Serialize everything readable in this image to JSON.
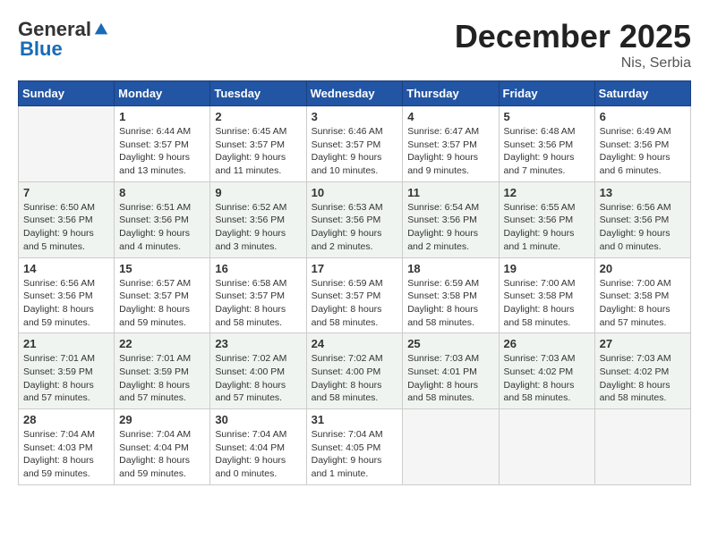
{
  "logo": {
    "general": "General",
    "blue": "Blue"
  },
  "title": "December 2025",
  "location": "Nis, Serbia",
  "days_of_week": [
    "Sunday",
    "Monday",
    "Tuesday",
    "Wednesday",
    "Thursday",
    "Friday",
    "Saturday"
  ],
  "weeks": [
    [
      {
        "day": "",
        "info": ""
      },
      {
        "day": "1",
        "info": "Sunrise: 6:44 AM\nSunset: 3:57 PM\nDaylight: 9 hours\nand 13 minutes."
      },
      {
        "day": "2",
        "info": "Sunrise: 6:45 AM\nSunset: 3:57 PM\nDaylight: 9 hours\nand 11 minutes."
      },
      {
        "day": "3",
        "info": "Sunrise: 6:46 AM\nSunset: 3:57 PM\nDaylight: 9 hours\nand 10 minutes."
      },
      {
        "day": "4",
        "info": "Sunrise: 6:47 AM\nSunset: 3:57 PM\nDaylight: 9 hours\nand 9 minutes."
      },
      {
        "day": "5",
        "info": "Sunrise: 6:48 AM\nSunset: 3:56 PM\nDaylight: 9 hours\nand 7 minutes."
      },
      {
        "day": "6",
        "info": "Sunrise: 6:49 AM\nSunset: 3:56 PM\nDaylight: 9 hours\nand 6 minutes."
      }
    ],
    [
      {
        "day": "7",
        "info": "Sunrise: 6:50 AM\nSunset: 3:56 PM\nDaylight: 9 hours\nand 5 minutes."
      },
      {
        "day": "8",
        "info": "Sunrise: 6:51 AM\nSunset: 3:56 PM\nDaylight: 9 hours\nand 4 minutes."
      },
      {
        "day": "9",
        "info": "Sunrise: 6:52 AM\nSunset: 3:56 PM\nDaylight: 9 hours\nand 3 minutes."
      },
      {
        "day": "10",
        "info": "Sunrise: 6:53 AM\nSunset: 3:56 PM\nDaylight: 9 hours\nand 2 minutes."
      },
      {
        "day": "11",
        "info": "Sunrise: 6:54 AM\nSunset: 3:56 PM\nDaylight: 9 hours\nand 2 minutes."
      },
      {
        "day": "12",
        "info": "Sunrise: 6:55 AM\nSunset: 3:56 PM\nDaylight: 9 hours\nand 1 minute."
      },
      {
        "day": "13",
        "info": "Sunrise: 6:56 AM\nSunset: 3:56 PM\nDaylight: 9 hours\nand 0 minutes."
      }
    ],
    [
      {
        "day": "14",
        "info": "Sunrise: 6:56 AM\nSunset: 3:56 PM\nDaylight: 8 hours\nand 59 minutes."
      },
      {
        "day": "15",
        "info": "Sunrise: 6:57 AM\nSunset: 3:57 PM\nDaylight: 8 hours\nand 59 minutes."
      },
      {
        "day": "16",
        "info": "Sunrise: 6:58 AM\nSunset: 3:57 PM\nDaylight: 8 hours\nand 58 minutes."
      },
      {
        "day": "17",
        "info": "Sunrise: 6:59 AM\nSunset: 3:57 PM\nDaylight: 8 hours\nand 58 minutes."
      },
      {
        "day": "18",
        "info": "Sunrise: 6:59 AM\nSunset: 3:58 PM\nDaylight: 8 hours\nand 58 minutes."
      },
      {
        "day": "19",
        "info": "Sunrise: 7:00 AM\nSunset: 3:58 PM\nDaylight: 8 hours\nand 58 minutes."
      },
      {
        "day": "20",
        "info": "Sunrise: 7:00 AM\nSunset: 3:58 PM\nDaylight: 8 hours\nand 57 minutes."
      }
    ],
    [
      {
        "day": "21",
        "info": "Sunrise: 7:01 AM\nSunset: 3:59 PM\nDaylight: 8 hours\nand 57 minutes."
      },
      {
        "day": "22",
        "info": "Sunrise: 7:01 AM\nSunset: 3:59 PM\nDaylight: 8 hours\nand 57 minutes."
      },
      {
        "day": "23",
        "info": "Sunrise: 7:02 AM\nSunset: 4:00 PM\nDaylight: 8 hours\nand 57 minutes."
      },
      {
        "day": "24",
        "info": "Sunrise: 7:02 AM\nSunset: 4:00 PM\nDaylight: 8 hours\nand 58 minutes."
      },
      {
        "day": "25",
        "info": "Sunrise: 7:03 AM\nSunset: 4:01 PM\nDaylight: 8 hours\nand 58 minutes."
      },
      {
        "day": "26",
        "info": "Sunrise: 7:03 AM\nSunset: 4:02 PM\nDaylight: 8 hours\nand 58 minutes."
      },
      {
        "day": "27",
        "info": "Sunrise: 7:03 AM\nSunset: 4:02 PM\nDaylight: 8 hours\nand 58 minutes."
      }
    ],
    [
      {
        "day": "28",
        "info": "Sunrise: 7:04 AM\nSunset: 4:03 PM\nDaylight: 8 hours\nand 59 minutes."
      },
      {
        "day": "29",
        "info": "Sunrise: 7:04 AM\nSunset: 4:04 PM\nDaylight: 8 hours\nand 59 minutes."
      },
      {
        "day": "30",
        "info": "Sunrise: 7:04 AM\nSunset: 4:04 PM\nDaylight: 9 hours\nand 0 minutes."
      },
      {
        "day": "31",
        "info": "Sunrise: 7:04 AM\nSunset: 4:05 PM\nDaylight: 9 hours\nand 1 minute."
      },
      {
        "day": "",
        "info": ""
      },
      {
        "day": "",
        "info": ""
      },
      {
        "day": "",
        "info": ""
      }
    ]
  ]
}
